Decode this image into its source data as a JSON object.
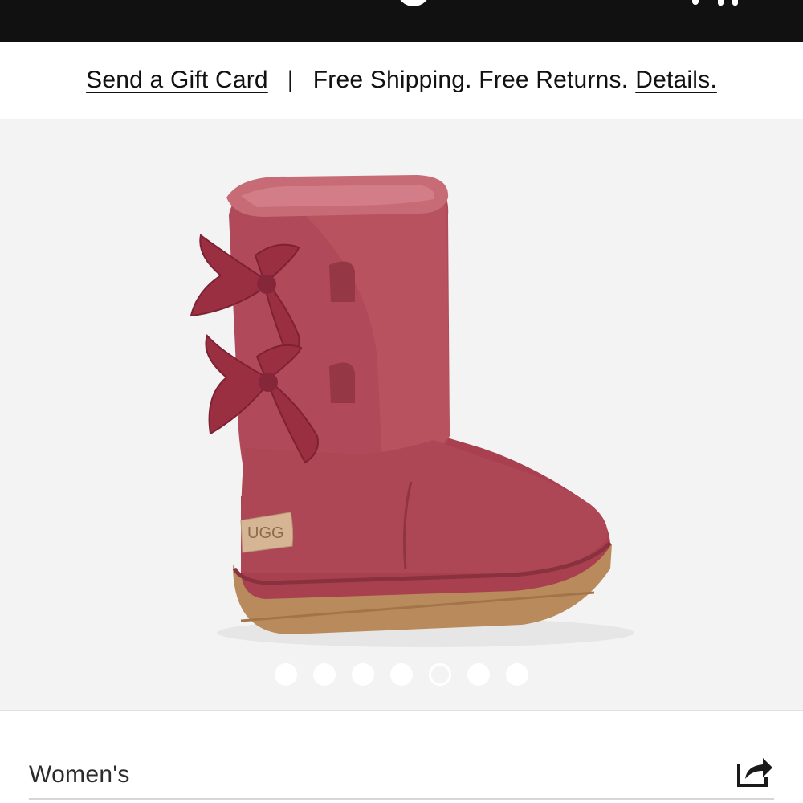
{
  "header": {
    "logo_icon": "brand-logo-fragment",
    "icons": [
      "account-icon",
      "bag-icon"
    ]
  },
  "promo": {
    "gift_card_link": "Send a Gift Card",
    "separator": "|",
    "shipping_text": "Free Shipping. Free Returns.",
    "details_link": "Details."
  },
  "gallery": {
    "brand_label": "UGG",
    "slide_count": 7,
    "active_slide": 5,
    "colors": {
      "boot": "#b04a5a",
      "sole": "#b98a5c",
      "background": "#f3f3f3"
    }
  },
  "product": {
    "category": "Women's",
    "share_icon": "share-icon"
  }
}
